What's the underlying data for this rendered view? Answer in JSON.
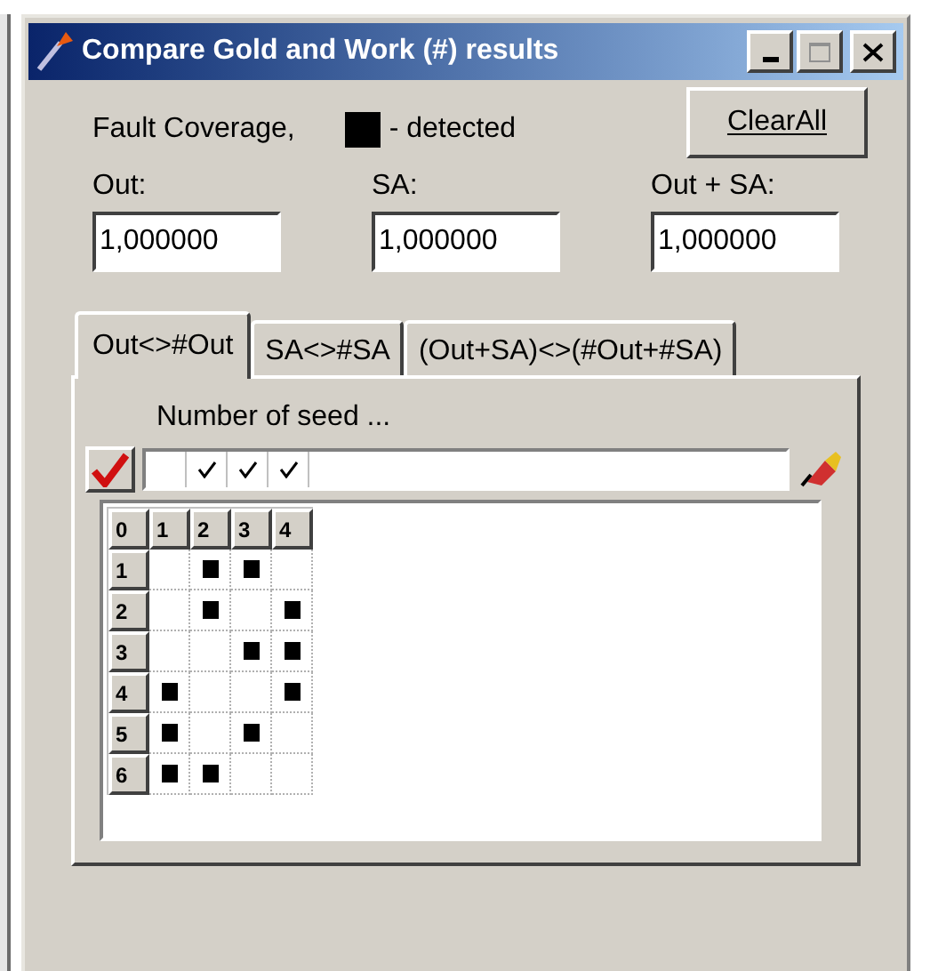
{
  "window": {
    "title": "Compare Gold and Work (#) results"
  },
  "legend": {
    "label": "Fault Coverage,",
    "swatch_text": "- detected"
  },
  "clear_button": "ClearAll",
  "fields": [
    {
      "label": "Out:",
      "value": "1,000000"
    },
    {
      "label": "SA:",
      "value": "1,000000"
    },
    {
      "label": "Out + SA:",
      "value": "1,000000"
    }
  ],
  "tabs": [
    {
      "label": "Out<>#Out",
      "selected": true
    },
    {
      "label": "SA<>#SA",
      "selected": false
    },
    {
      "label": "(Out+SA)<>(#Out+#SA)",
      "selected": false
    }
  ],
  "seed_label": "Number of seed ...",
  "seed_cells": [
    {
      "checked": false
    },
    {
      "checked": true
    },
    {
      "checked": true
    },
    {
      "checked": true
    }
  ],
  "grid": {
    "corner": "0",
    "columns": [
      "1",
      "2",
      "3",
      "4"
    ],
    "rows": [
      {
        "label": "1",
        "cells": [
          false,
          true,
          true,
          false
        ]
      },
      {
        "label": "2",
        "cells": [
          false,
          true,
          false,
          true
        ]
      },
      {
        "label": "3",
        "cells": [
          false,
          false,
          true,
          true
        ]
      },
      {
        "label": "4",
        "cells": [
          true,
          false,
          false,
          true
        ]
      },
      {
        "label": "5",
        "cells": [
          true,
          false,
          true,
          false
        ]
      },
      {
        "label": "6",
        "cells": [
          true,
          true,
          false,
          false
        ]
      }
    ]
  }
}
